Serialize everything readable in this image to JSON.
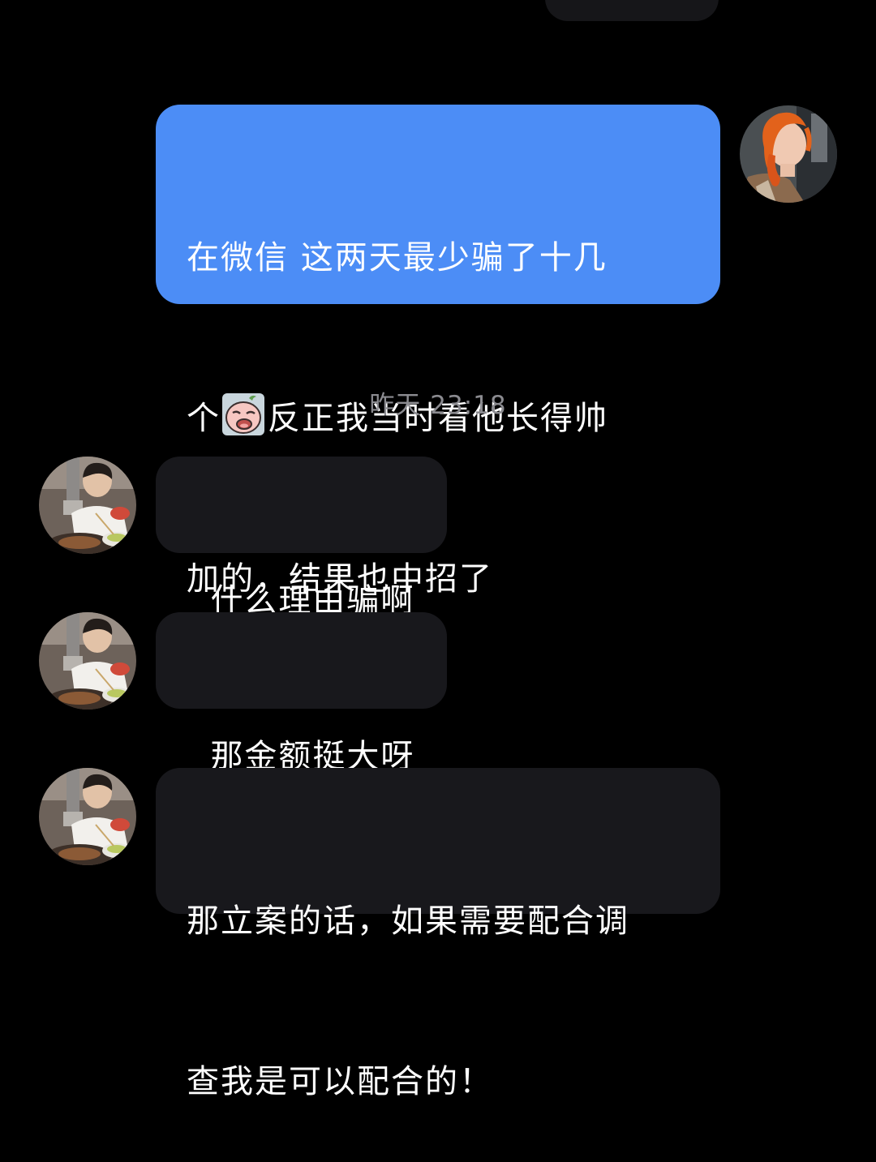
{
  "messages": {
    "outgoing": {
      "text_line1": "在微信 这两天最少骗了十几",
      "text_line2_before_emoji": "个",
      "emoji": "crying-face-emoji",
      "text_line2_after_emoji": "反正我当时看他长得帅",
      "text_line3": "加的，结果也中招了",
      "avatar": "orange-hair-woman-avatar"
    },
    "timestamp": "昨天 23:18",
    "incoming": [
      {
        "text": "什么理由骗啊",
        "avatar": "man-eating-avatar"
      },
      {
        "text": "那金额挺大呀",
        "avatar": "man-eating-avatar"
      },
      {
        "text_line1": "那立案的话，如果需要配合调",
        "text_line2": "查我是可以配合的！",
        "avatar": "man-eating-avatar"
      }
    ]
  },
  "colors": {
    "background": "#000000",
    "outgoing_bubble": "#4c8df6",
    "incoming_bubble": "#18181c",
    "timestamp_text": "#8b8b90"
  }
}
